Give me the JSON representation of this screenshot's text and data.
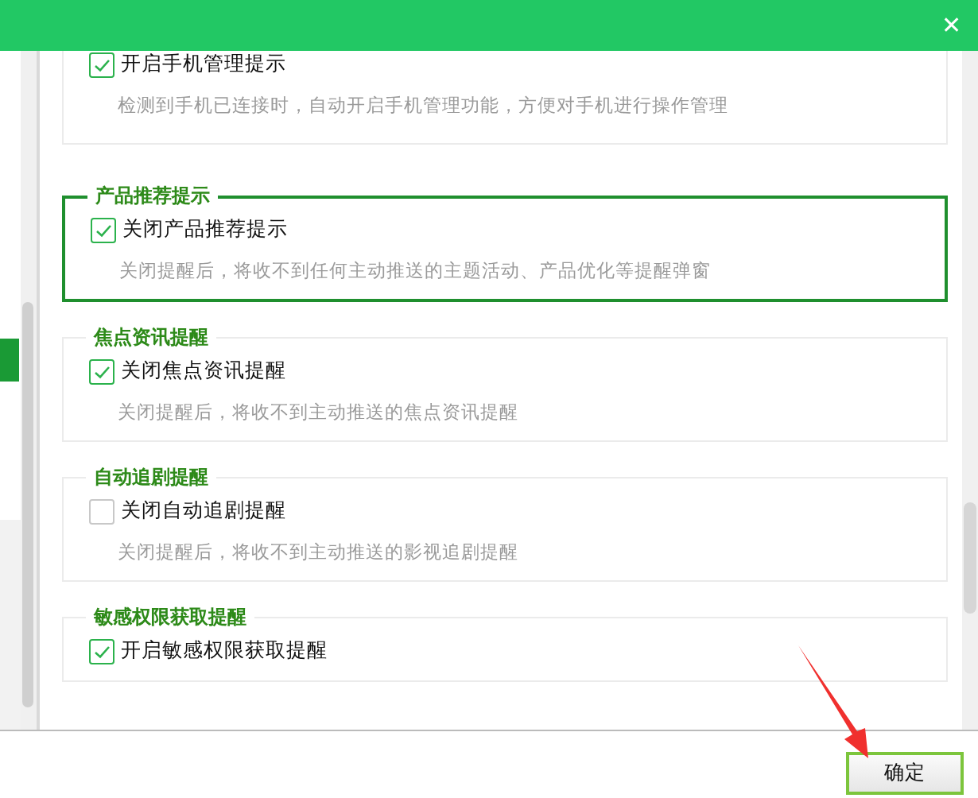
{
  "window": {
    "close": "✕"
  },
  "sections": [
    {
      "highlighted": false,
      "option": {
        "label": "开启手机管理提示",
        "checked": true
      },
      "description": "检测到手机已连接时，自动开启手机管理功能，方便对手机进行操作管理"
    },
    {
      "title": "产品推荐提示",
      "highlighted": true,
      "option": {
        "label": "关闭产品推荐提示",
        "checked": true
      },
      "description": "关闭提醒后，将收不到任何主动推送的主题活动、产品优化等提醒弹窗"
    },
    {
      "title": "焦点资讯提醒",
      "highlighted": false,
      "option": {
        "label": "关闭焦点资讯提醒",
        "checked": true
      },
      "description": "关闭提醒后，将收不到主动推送的焦点资讯提醒"
    },
    {
      "title": "自动追剧提醒",
      "highlighted": false,
      "option": {
        "label": "关闭自动追剧提醒",
        "checked": false
      },
      "description": "关闭提醒后，将收不到主动推送的影视追剧提醒"
    },
    {
      "title": "敏感权限获取提醒",
      "highlighted": false,
      "option": {
        "label": "开启敏感权限获取提醒",
        "checked": true
      }
    }
  ],
  "footer": {
    "confirm": "确定"
  }
}
